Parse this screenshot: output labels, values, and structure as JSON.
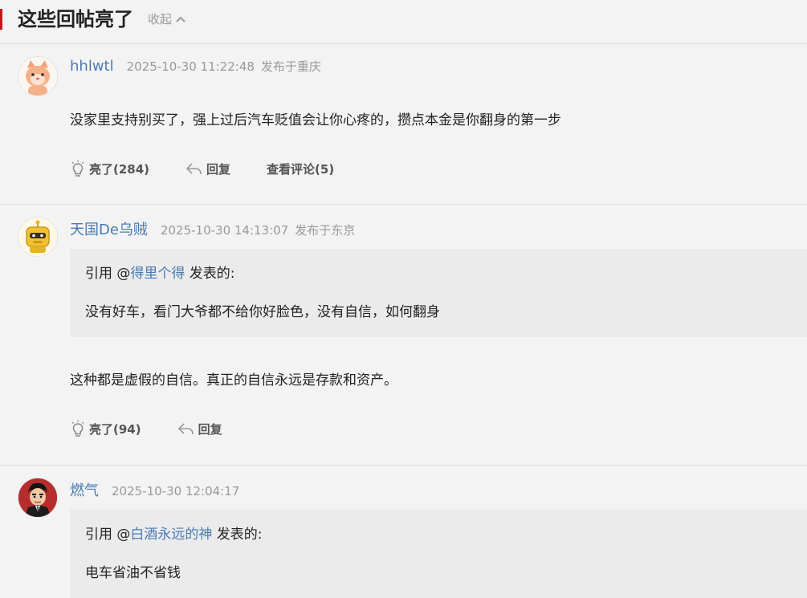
{
  "header": {
    "title": "这些回帖亮了",
    "collapse_label": "收起"
  },
  "posts": [
    {
      "username": "hhlwtl",
      "time": "2025-10-30 11:22:48",
      "location": "发布于重庆",
      "content": "没家里支持别买了，强上过后汽车贬值会让你心疼的，攒点本金是你翻身的第一步",
      "like_label": "亮了(284)",
      "reply_label": "回复",
      "view_comments_label": "查看评论(5)"
    },
    {
      "username": "天国De乌贼",
      "time": "2025-10-30 14:13:07",
      "location": "发布于东京",
      "quote": {
        "prefix": "引用 @",
        "user": "得里个得",
        "suffix": " 发表的:",
        "text": "没有好车，看门大爷都不给你好脸色，没有自信，如何翻身"
      },
      "content": "这种都是虚假的自信。真正的自信永远是存款和资产。",
      "like_label": "亮了(94)",
      "reply_label": "回复"
    },
    {
      "username": "燃气",
      "time": "2025-10-30 12:04:17",
      "quote": {
        "prefix": "引用 @",
        "user": "白酒永远的神",
        "suffix": " 发表的:",
        "text": "电车省油不省钱"
      }
    }
  ],
  "colors": {
    "accent": "#c8161d",
    "link": "#4a7bb0",
    "background": "#f3f3f4",
    "quote_bg": "#ebebec"
  }
}
